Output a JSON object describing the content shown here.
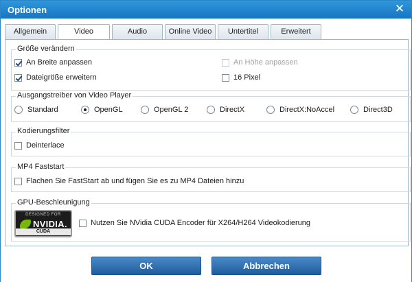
{
  "window": {
    "title": "Optionen"
  },
  "tabs": [
    {
      "label": "Allgemein",
      "active": false
    },
    {
      "label": "Video",
      "active": true
    },
    {
      "label": "Audio",
      "active": false
    },
    {
      "label": "Online Video",
      "active": false
    },
    {
      "label": "Untertitel",
      "active": false
    },
    {
      "label": "Erweitert",
      "active": false
    }
  ],
  "resize": {
    "title": "Größe verändern",
    "fit_width": {
      "label": "An Breite anpassen",
      "checked": true
    },
    "fit_height": {
      "label": "An Höhe anpassen",
      "checked": false,
      "disabled": true
    },
    "extend_size": {
      "label": "Dateigröße erweitern",
      "checked": true
    },
    "pixel16": {
      "label": "16 Pixel",
      "checked": false
    }
  },
  "driver": {
    "title": "Ausgangstreiber von Video Player",
    "options": [
      {
        "label": "Standard",
        "selected": false
      },
      {
        "label": "OpenGL",
        "selected": true
      },
      {
        "label": "OpenGL 2",
        "selected": false
      },
      {
        "label": "DirectX",
        "selected": false
      },
      {
        "label": "DirectX:NoAccel",
        "selected": false
      },
      {
        "label": "Direct3D",
        "selected": false
      }
    ]
  },
  "encoding": {
    "title": "Kodierungsfilter",
    "deinterlace": {
      "label": "Deinterlace",
      "checked": false
    }
  },
  "faststart": {
    "title": "MP4 Faststart",
    "option": {
      "label": "Flachen Sie FastStart ab und fügen Sie es zu MP4 Dateien hinzu",
      "checked": false
    }
  },
  "gpu": {
    "title": "GPU-Beschleunigung",
    "badge": {
      "top": "DESIGNED FOR",
      "brand": "NVIDIA.",
      "bottom": "CUDA"
    },
    "option": {
      "label": "Nutzen Sie NVidia CUDA Encoder für X264/H264 Videokodierung",
      "checked": false
    }
  },
  "buttons": {
    "ok": "OK",
    "cancel": "Abbrechen"
  },
  "colors": {
    "accent": "#1f5c9e",
    "titlebar": "#1775c2",
    "nvidia_green": "#76b900"
  }
}
